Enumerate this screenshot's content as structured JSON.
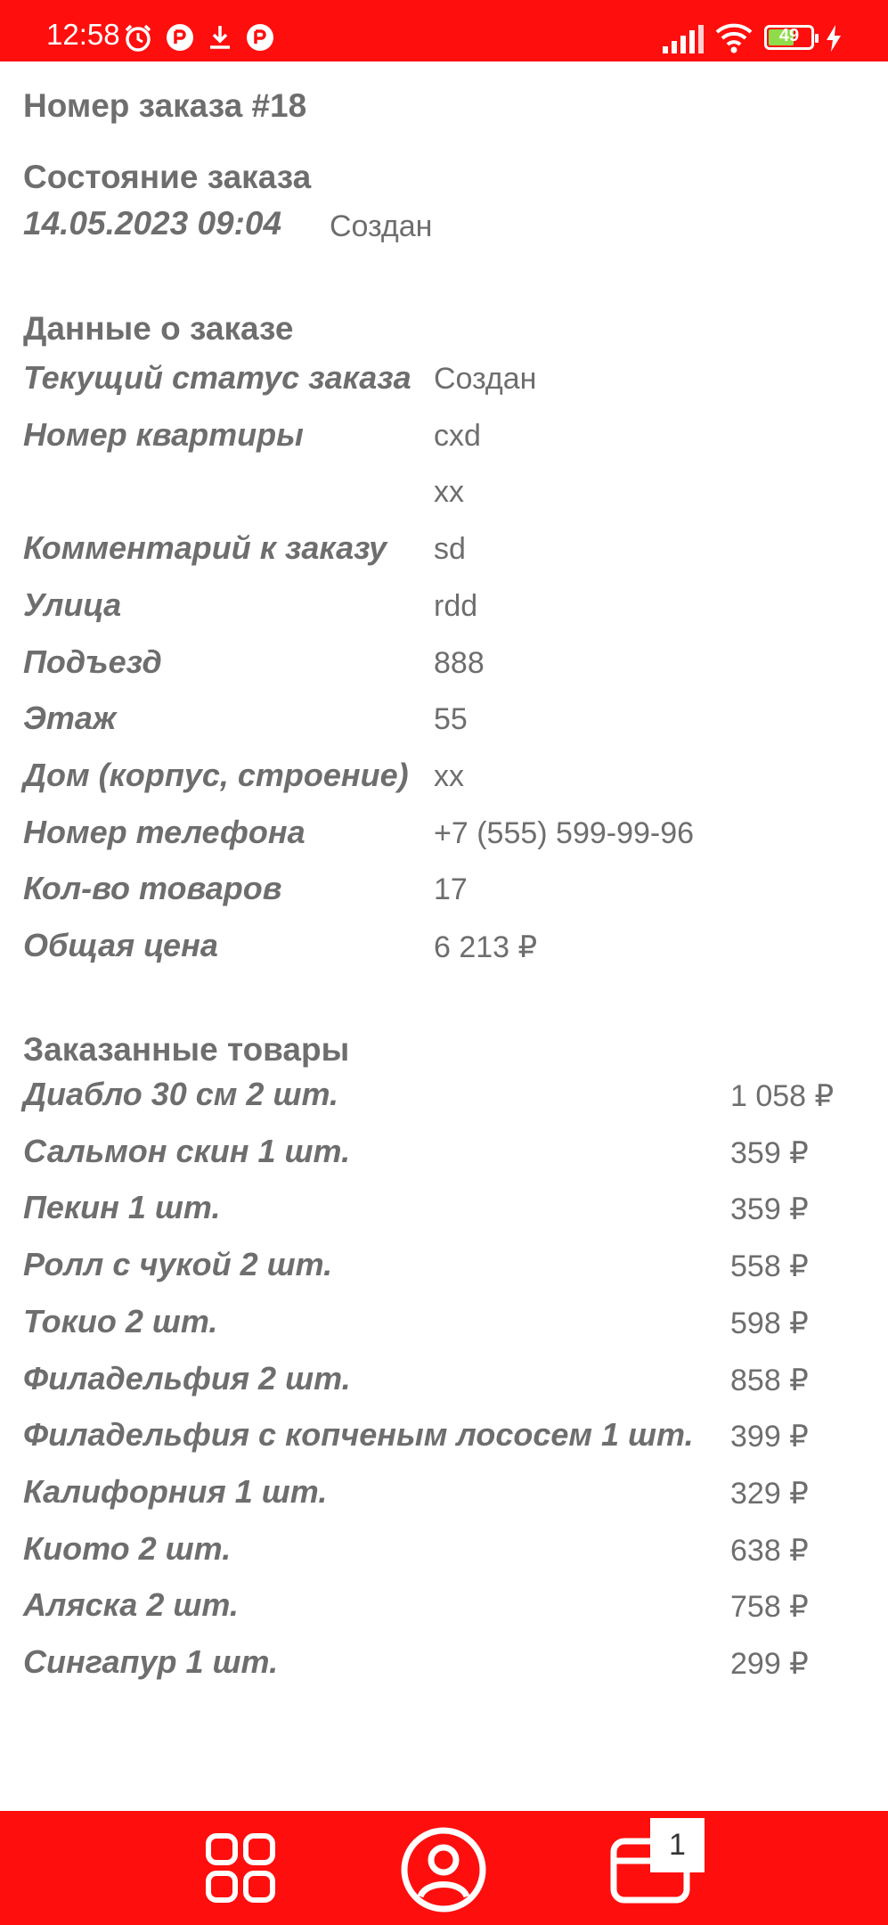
{
  "status_bar": {
    "time": "12:58",
    "battery": "49",
    "colors": {
      "background": "#ff0e0e",
      "foreground": "#ffffff"
    },
    "left_icons": [
      "alarm-icon",
      "app-icon",
      "download-icon",
      "app-icon"
    ],
    "right_icons": [
      "signal-icon",
      "wifi-icon",
      "battery-icon",
      "charging-icon"
    ]
  },
  "order": {
    "title": "Номер заказа #18",
    "state_heading": "Состояние заказа",
    "state_date": "14.05.2023 09:04",
    "state_value": "Создан"
  },
  "details": {
    "heading": "Данные о заказе",
    "rows": [
      {
        "label": "Текущий статус заказа",
        "value": "Создан"
      },
      {
        "label": "Номер квартиры",
        "value": "cxd"
      },
      {
        "label": "",
        "value": "xx"
      },
      {
        "label": "Комментарий к заказу",
        "value": "sd"
      },
      {
        "label": "Улица",
        "value": "rdd"
      },
      {
        "label": "Подъезд",
        "value": "888"
      },
      {
        "label": "Этаж",
        "value": "55"
      },
      {
        "label": "Дом (корпус, строение)",
        "value": "xx"
      },
      {
        "label": "Номер телефона",
        "value": "+7 (555) 599-99-96"
      },
      {
        "label": "Кол-во товаров",
        "value": "17"
      },
      {
        "label": "Общая цена",
        "value": "6 213 ₽"
      }
    ]
  },
  "products": {
    "heading": "Заказанные товары",
    "items": [
      {
        "name": "Диабло  30 см 2 шт.",
        "price": "1 058 ₽"
      },
      {
        "name": "Сальмон скин 1 шт.",
        "price": "359 ₽"
      },
      {
        "name": "Пекин 1 шт.",
        "price": "359 ₽"
      },
      {
        "name": "Ролл с чукой 2 шт.",
        "price": "558 ₽"
      },
      {
        "name": "Токио 2 шт.",
        "price": "598 ₽"
      },
      {
        "name": "Филадельфия 2 шт.",
        "price": "858 ₽"
      },
      {
        "name": "Филадельфия с копченым лососем 1 шт.",
        "price": "399 ₽"
      },
      {
        "name": "Калифорния 1 шт.",
        "price": "329 ₽"
      },
      {
        "name": "Киото 2 шт.",
        "price": "638 ₽"
      },
      {
        "name": "Аляска 2 шт.",
        "price": "758 ₽"
      },
      {
        "name": "Сингапур 1 шт.",
        "price": "299 ₽"
      }
    ]
  },
  "bottom_nav": {
    "colors": {
      "background": "#ff0e0e",
      "icon": "#ffffff"
    },
    "items": [
      {
        "icon": "grid-icon"
      },
      {
        "icon": "profile-icon"
      },
      {
        "icon": "cart-icon"
      }
    ],
    "cart_badge": "1"
  }
}
